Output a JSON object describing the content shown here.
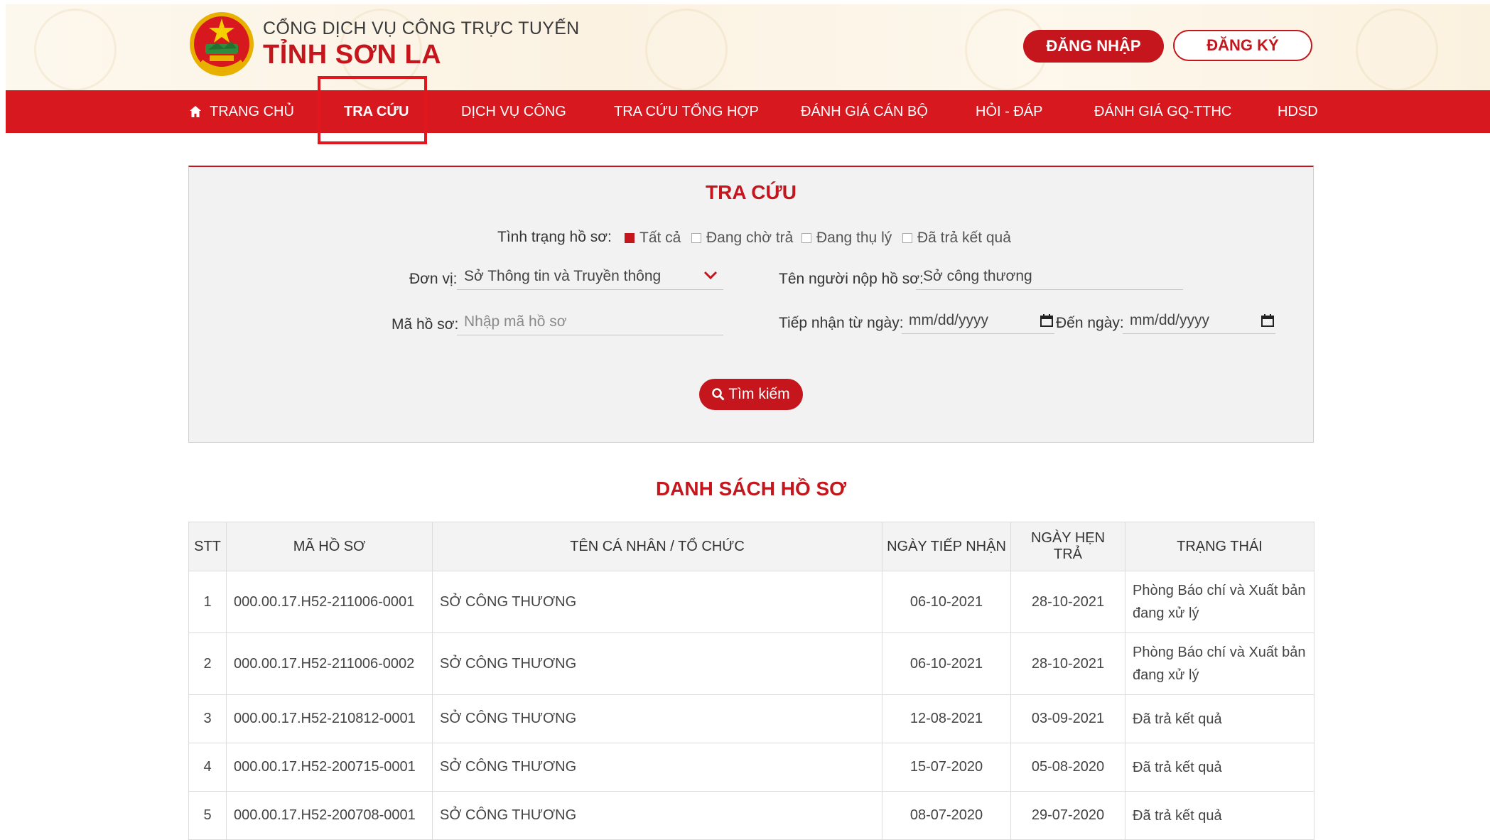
{
  "header": {
    "subtitle": "CỔNG DỊCH VỤ CÔNG TRỰC TUYẾN",
    "title": "TỈNH SƠN LA",
    "login_label": "ĐĂNG NHẬP",
    "register_label": "ĐĂNG KÝ",
    "logo_text": "SƠN LA"
  },
  "nav": {
    "items": [
      {
        "label": "TRANG CHỦ",
        "icon": "home-icon"
      },
      {
        "label": "TRA CỨU",
        "active": true
      },
      {
        "label": "DỊCH VỤ CÔNG"
      },
      {
        "label": "TRA CỨU TỔNG HỢP"
      },
      {
        "label": "ĐÁNH GIÁ CÁN BỘ"
      },
      {
        "label": "HỎI - ĐÁP"
      },
      {
        "label": "ĐÁNH GIÁ GQ-TTHC"
      },
      {
        "label": "HDSD"
      }
    ]
  },
  "search": {
    "title": "TRA CỨU",
    "status_label": "Tình trạng hồ sơ:",
    "status_options": [
      {
        "label": "Tất cả",
        "checked": true
      },
      {
        "label": "Đang chờ trả",
        "checked": false
      },
      {
        "label": "Đang thụ lý",
        "checked": false
      },
      {
        "label": "Đã trả kết quả",
        "checked": false
      }
    ],
    "unit_label": "Đơn vị:",
    "unit_value": "Sở Thông tin và Truyền thông",
    "submitter_label": "Tên người nộp hồ sơ:",
    "submitter_value": "Sở công thương",
    "code_label": "Mã hồ sơ:",
    "code_placeholder": "Nhập mã hồ sơ",
    "from_label": "Tiếp nhận từ ngày:",
    "from_value": "mm/dd/yyyy",
    "to_label": "Đến ngày:",
    "to_value": "mm/dd/yyyy",
    "button_label": "Tìm kiếm"
  },
  "list": {
    "title": "DANH SÁCH HỒ SƠ",
    "columns": [
      "STT",
      "MÃ HỒ SƠ",
      "TÊN CÁ NHÂN / TỔ CHỨC",
      "NGÀY TIẾP NHẬN",
      "NGÀY HẸN TRẢ",
      "TRẠNG THÁI"
    ],
    "rows": [
      {
        "stt": "1",
        "code": "000.00.17.H52-211006-0001",
        "name": "SỞ CÔNG THƯƠNG",
        "received": "06-10-2021",
        "due": "28-10-2021",
        "status": "Phòng Báo chí và Xuất bản đang xử lý"
      },
      {
        "stt": "2",
        "code": "000.00.17.H52-211006-0002",
        "name": "SỞ CÔNG THƯƠNG",
        "received": "06-10-2021",
        "due": "28-10-2021",
        "status": "Phòng Báo chí và Xuất bản đang xử lý"
      },
      {
        "stt": "3",
        "code": "000.00.17.H52-210812-0001",
        "name": "SỞ CÔNG THƯƠNG",
        "received": "12-08-2021",
        "due": "03-09-2021",
        "status": "Đã trả kết quả"
      },
      {
        "stt": "4",
        "code": "000.00.17.H52-200715-0001",
        "name": "SỞ CÔNG THƯƠNG",
        "received": "15-07-2020",
        "due": "05-08-2020",
        "status": "Đã trả kết quả"
      },
      {
        "stt": "5",
        "code": "000.00.17.H52-200708-0001",
        "name": "SỞ CÔNG THƯƠNG",
        "received": "08-07-2020",
        "due": "29-07-2020",
        "status": "Đã trả kết quả"
      }
    ]
  }
}
